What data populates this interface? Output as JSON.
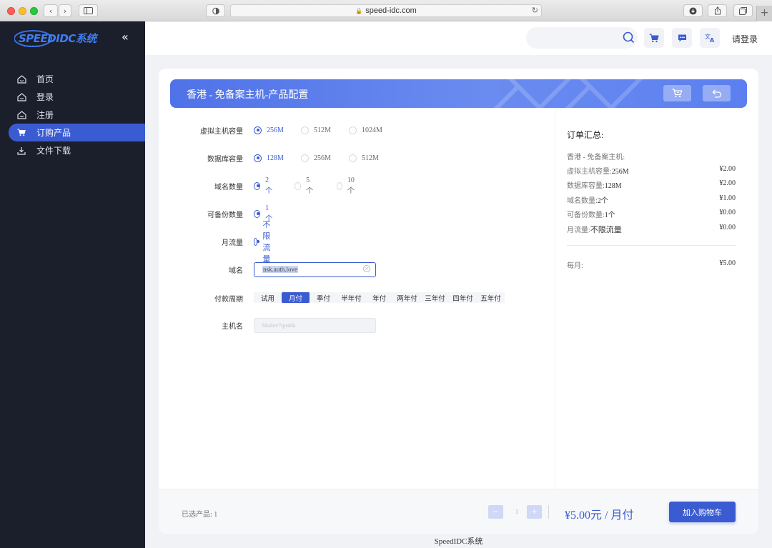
{
  "browser": {
    "url": "speed-idc.com"
  },
  "sidebar": {
    "logo_text": "SPEEDIDC系统",
    "items": [
      {
        "label": "首页",
        "icon": "home-icon",
        "active": false
      },
      {
        "label": "登录",
        "icon": "home-icon",
        "active": false
      },
      {
        "label": "注册",
        "icon": "home-icon",
        "active": false
      },
      {
        "label": "订购产品",
        "icon": "cart-icon",
        "active": true
      },
      {
        "label": "文件下载",
        "icon": "download-icon",
        "active": false
      }
    ]
  },
  "header": {
    "search_placeholder": "",
    "login_label": "请登录"
  },
  "banner": {
    "title": "香港 - 免备案主机-产品配置"
  },
  "form": {
    "vhost_capacity": {
      "label": "虚拟主机容量",
      "options": [
        "256M",
        "512M",
        "1024M"
      ],
      "selected": "256M"
    },
    "db_capacity": {
      "label": "数据库容量",
      "options": [
        "128M",
        "256M",
        "512M"
      ],
      "selected": "128M"
    },
    "domain_count": {
      "label": "域名数量",
      "options": [
        "2个",
        "5个",
        "10个"
      ],
      "selected": "2个"
    },
    "backup_count": {
      "label": "可备份数量",
      "options": [
        "1个"
      ],
      "selected": "1个"
    },
    "monthly_traffic": {
      "label": "月流量",
      "options": [
        "不限流量"
      ],
      "selected": "不限流量"
    },
    "domain": {
      "label": "域名",
      "value": "nsk.auth.love"
    },
    "billing_cycle": {
      "label": "付款周期",
      "options": [
        "试用",
        "月付",
        "季付",
        "半年付",
        "年付",
        "两年付",
        "三年付",
        "四年付",
        "五年付"
      ],
      "selected": "月付"
    },
    "hostname": {
      "label": "主机名",
      "placeholder": "hkuluv7qu4du"
    }
  },
  "summary": {
    "title": "订单汇总:",
    "product": "香港 - 免备案主机:",
    "lines": [
      {
        "name": "虚拟主机容量:",
        "value": "256M",
        "price": "¥2.00"
      },
      {
        "name": "数据库容量:",
        "value": "128M",
        "price": "¥2.00"
      },
      {
        "name": "域名数量:",
        "value": "2个",
        "price": "¥1.00"
      },
      {
        "name": "可备份数量:",
        "value": "1个",
        "price": "¥0.00"
      },
      {
        "name": "月流量:",
        "value": "不限流量",
        "price": "¥0.00"
      }
    ],
    "period_label": "每月:",
    "period_total": "¥5.00"
  },
  "footer": {
    "selected_text": "已选产品: 1",
    "quantity": "1",
    "price_text": "¥5.00元 / 月付",
    "add_cart_label": "加入购物车"
  },
  "copyright": "SpeedIDC系统",
  "colors": {
    "accent": "#3a5bd1",
    "sidebar_bg": "#1b1e2b",
    "page_bg": "#f0f2f5"
  }
}
